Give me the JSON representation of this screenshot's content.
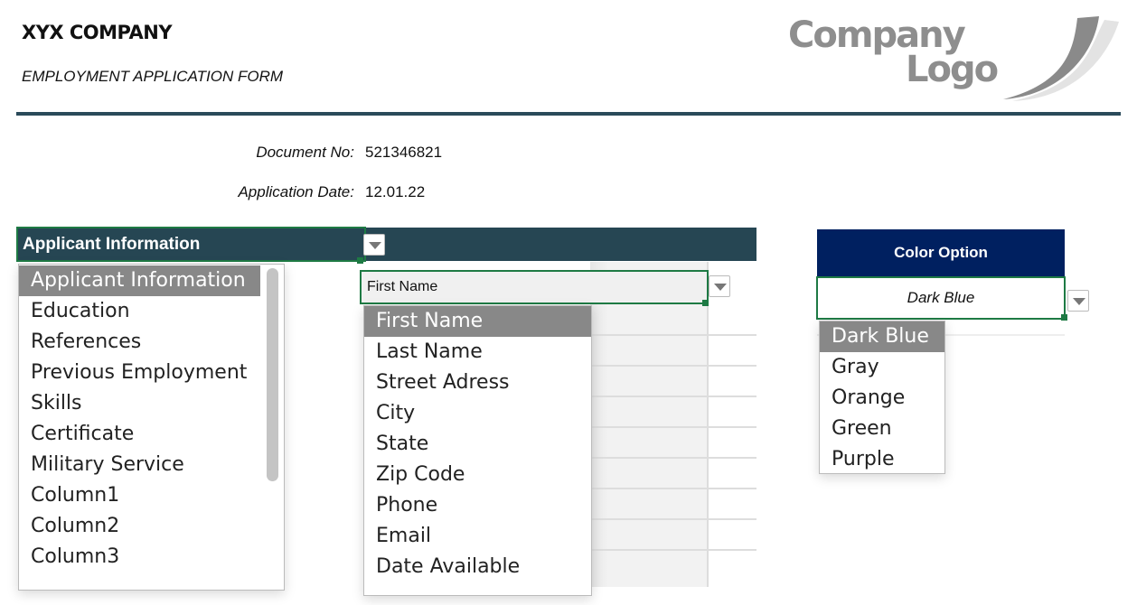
{
  "header": {
    "company": "XYX COMPANY",
    "form_title": "EMPLOYMENT APPLICATION FORM",
    "logo_text": "Company Logo"
  },
  "document": {
    "doc_no_label": "Document No:",
    "doc_no": "521346821",
    "date_label": "Application Date:",
    "date": "12.01.22"
  },
  "section_dropdown": {
    "value": "Applicant Information",
    "options": [
      "Applicant Information",
      "Education",
      "References",
      "Previous Employment",
      "Skills",
      "Certificate",
      "Military Service",
      "Column1",
      "Column2",
      "Column3"
    ],
    "selected": 0
  },
  "field_dropdown": {
    "value": "First Name",
    "options": [
      "First Name",
      "Last Name",
      "Street Adress",
      "City",
      "State",
      "Zip Code",
      "Phone",
      "Email",
      "Date Available"
    ],
    "selected": 0
  },
  "color_option": {
    "label": "Color Option",
    "value": "Dark Blue",
    "options": [
      "Dark Blue",
      "Gray",
      "Orange",
      "Green",
      "Purple"
    ],
    "selected": 0
  },
  "colors": {
    "header_bar": "#264653",
    "color_header": "#002060",
    "selection_border": "#1e7a44"
  }
}
